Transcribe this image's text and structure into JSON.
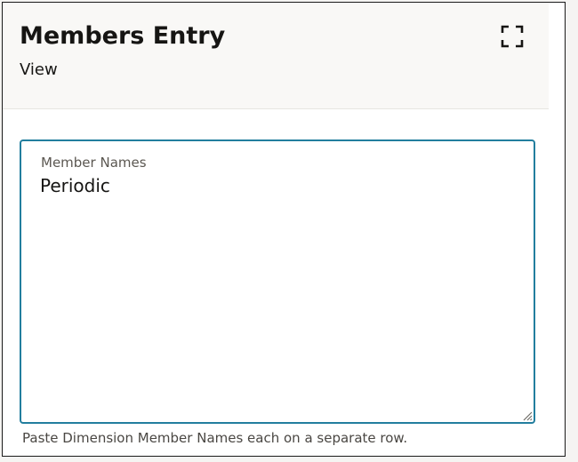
{
  "dialog": {
    "title": "Members Entry",
    "subtitle": "View",
    "expand_icon": "expand-icon"
  },
  "field": {
    "label": "Member Names",
    "value": "Periodic",
    "help_text": "Paste Dimension Member Names each on a separate row.",
    "resize_icon": "resize-handle-icon"
  },
  "colors": {
    "focus_border": "#227e9e",
    "header_bg": "#f9f8f6",
    "text": "#161513"
  }
}
